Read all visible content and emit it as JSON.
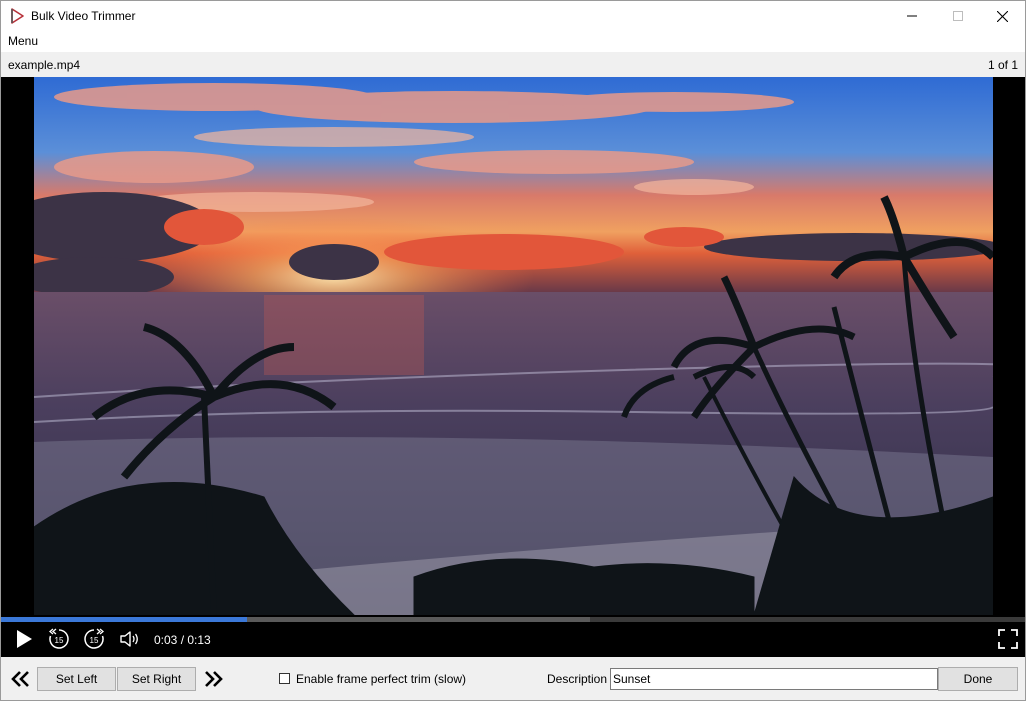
{
  "window": {
    "title": "Bulk Video Trimmer",
    "icon": "play-triangle-icon"
  },
  "menubar": {
    "items": [
      "Menu"
    ]
  },
  "file": {
    "name": "example.mp4",
    "counter": "1 of 1"
  },
  "player": {
    "progress_fraction": 0.24,
    "buffered_fraction": 0.575,
    "time_display": "0:03 / 0:13",
    "rewind_seconds": "15",
    "forward_seconds": "15",
    "colors": {
      "progress": "#3b78d8",
      "buffer": "#5a5a5a",
      "background": "#000000"
    }
  },
  "controls": {
    "set_left_label": "Set Left",
    "set_right_label": "Set Right",
    "frame_perfect_label": "Enable frame perfect trim (slow)",
    "frame_perfect_checked": false,
    "description_label": "Description",
    "description_value": "Sunset",
    "done_label": "Done"
  }
}
